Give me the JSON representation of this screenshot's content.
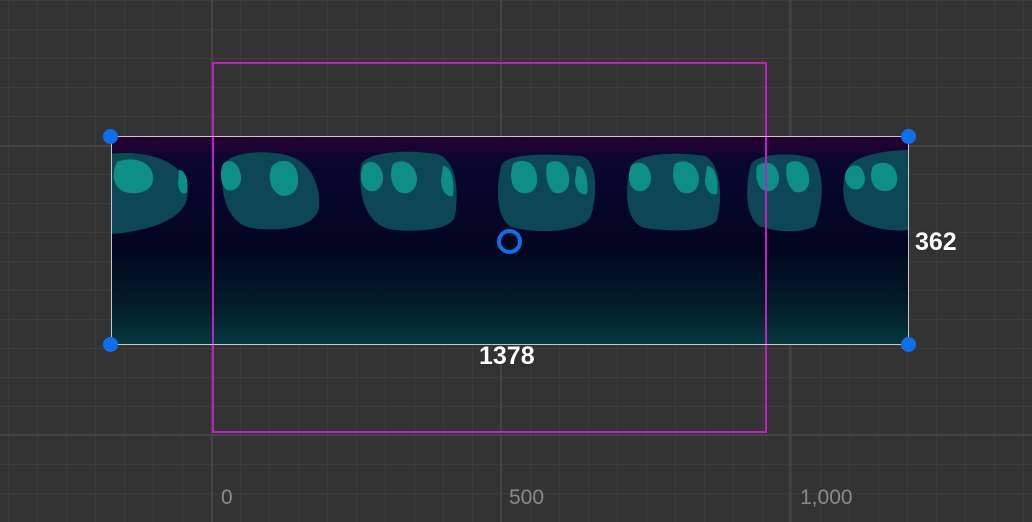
{
  "ruler": {
    "labels": [
      "0",
      "500",
      "1,000"
    ]
  },
  "selection": {
    "width_label": "1378",
    "height_label": "362"
  },
  "colors": {
    "background": "#333333",
    "grid_major": "#444444",
    "camera_bounds": "#c21ec6",
    "handle": "#0f6ee8",
    "selection_border": "#c8c8c8",
    "sprite_top": "#2a0033",
    "sprite_mid": "#04062a",
    "sprite_bottom": "#05303a",
    "blob_dark": "#0d4654",
    "blob_light": "#0e8f86"
  },
  "icons": {
    "pivot": "pivot-ring-icon",
    "handles": "resize-handle-icon"
  }
}
